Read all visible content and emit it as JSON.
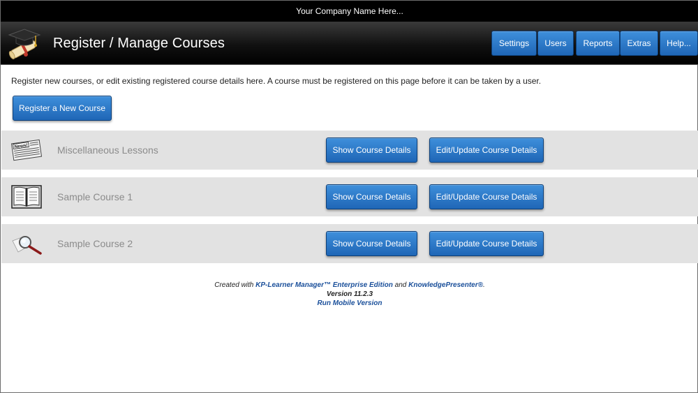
{
  "company_bar": {
    "text": "Your Company Name Here..."
  },
  "header": {
    "title": "Register / Manage Courses",
    "logo_icon": "graduation-cap-diploma-icon",
    "nav": [
      {
        "label": "Settings"
      },
      {
        "label": "Users"
      },
      {
        "label": "Reports"
      },
      {
        "label": "Extras"
      },
      {
        "label": "Help..."
      }
    ]
  },
  "main": {
    "intro": "Register new courses, or edit existing registered course details here. A course must be registered on this page before it can be taken by a user.",
    "register_button": "Register a New Course",
    "courses": [
      {
        "name": "Miscellaneous Lessons",
        "icon": "newspaper-icon",
        "show_label": "Show Course Details",
        "edit_label": "Edit/Update Course Details"
      },
      {
        "name": "Sample Course 1",
        "icon": "open-book-icon",
        "show_label": "Show Course Details",
        "edit_label": "Edit/Update Course Details"
      },
      {
        "name": "Sample Course 2",
        "icon": "magnifying-glass-icon",
        "show_label": "Show Course Details",
        "edit_label": "Edit/Update Course Details"
      }
    ]
  },
  "footer": {
    "created_with": "Created with",
    "product_link": "KP-Learner Manager™ Enterprise Edition",
    "and": "and",
    "presenter_link": "KnowledgePresenter®",
    "period": ".",
    "version": "Version 11.2.3",
    "mobile_link": "Run Mobile Version"
  },
  "colors": {
    "header_bg": "#000000",
    "button_blue": "#2a78c9",
    "row_bg": "#e2e2e2",
    "course_name": "#8b8b8b",
    "footer_link": "#1a4f9a"
  }
}
